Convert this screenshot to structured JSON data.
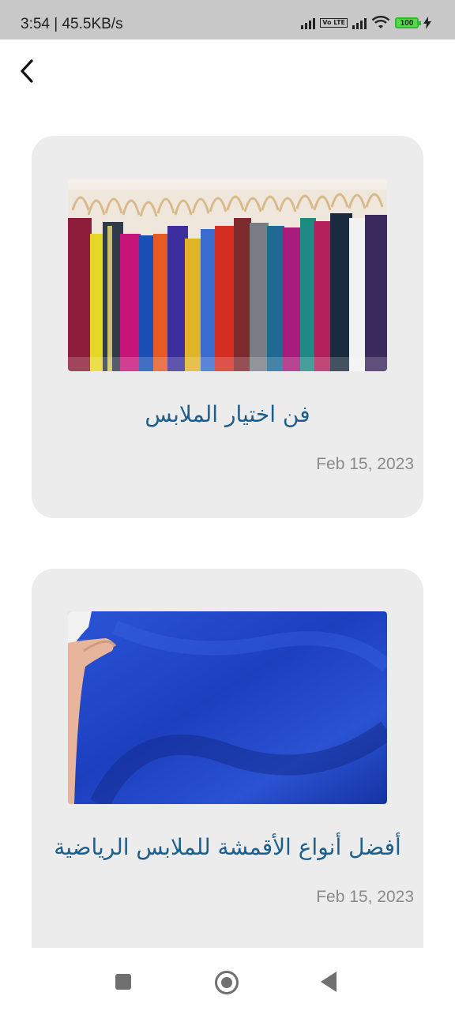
{
  "status_bar": {
    "time_speed": "3:54 | 45.5KB/s",
    "volte": "Vo LTE",
    "battery": "100"
  },
  "header": {
    "back_icon": "chevron-left-icon"
  },
  "articles": [
    {
      "title": "فن اختيار الملابس",
      "date": "Feb 15, 2023",
      "image": "clothes-on-hangers-photo"
    },
    {
      "title": "أفضل أنواع الأقمشة للملابس الرياضية",
      "date": "Feb 15, 2023",
      "image": "blue-fabric-photo"
    }
  ],
  "nav": {
    "recent_icon": "square-icon",
    "home_icon": "circle-icon",
    "back_icon": "triangle-back-icon"
  },
  "colors": {
    "title": "#1c5e8c",
    "card_bg": "#ececec",
    "date": "#8a8a8a"
  }
}
